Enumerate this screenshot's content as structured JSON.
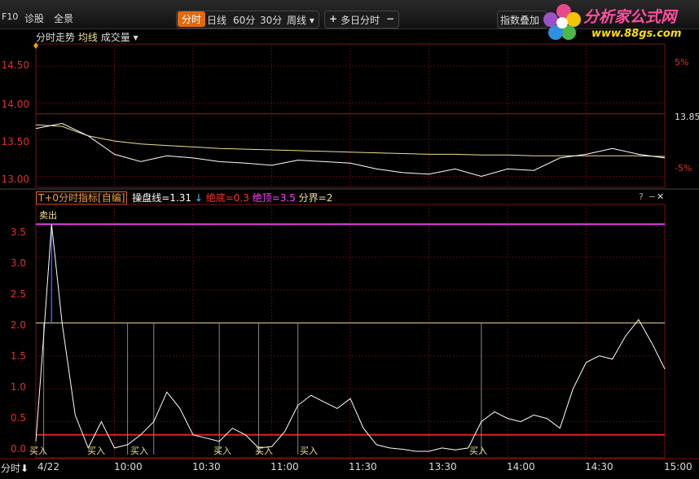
{
  "toolbar": {
    "f10": "F10",
    "diagnose": "诊股",
    "panorama": "全景",
    "periods": [
      "分时",
      "日线",
      "60分",
      "30分",
      "周线 ▾"
    ],
    "multiday": "多日分时",
    "plus": "+",
    "minus": "−",
    "index_overlay": "指数叠加"
  },
  "logo": {
    "text": "分析家公式网",
    "url": "www.88gs.com"
  },
  "top_panel": {
    "title": "分时走势",
    "avg_label": "均线",
    "vol_label": "成交量",
    "dropdown": "▾",
    "y_left": [
      "14.50",
      "14.00",
      "13.50",
      "13.00"
    ],
    "y_right": [
      "5%",
      "13.85",
      "-5%"
    ]
  },
  "bottom_panel": {
    "indicator": "T+0分时指标[自编]",
    "line_label": "操盘线=1.31",
    "arrow": "↓",
    "bottom_label": "绝底=0.3",
    "top_label": "绝顶=3.5",
    "divider_label": "分界=2",
    "help": "?",
    "collapse": "−",
    "close": "✕",
    "sell": "卖出",
    "buy": "买入",
    "y_left": [
      "3.5",
      "3.0",
      "2.5",
      "2.0",
      "1.5",
      "1.0",
      "0.5",
      "0.0"
    ]
  },
  "xaxis": {
    "mode_label": "分时",
    "mode_arrow": "⬇",
    "labels": [
      "4/22",
      "10:00",
      "10:30",
      "11:00",
      "11:30",
      "13:30",
      "14:00",
      "14:30",
      "15:00"
    ]
  },
  "chart_data": {
    "type": "line",
    "price": {
      "ylim": [
        12.85,
        14.8
      ],
      "prev_close": 13.85,
      "times": [
        "09:30",
        "09:40",
        "09:50",
        "10:00",
        "10:10",
        "10:20",
        "10:30",
        "10:40",
        "10:50",
        "11:00",
        "11:10",
        "11:20",
        "11:30",
        "13:10",
        "13:20",
        "13:30",
        "13:40",
        "13:50",
        "14:00",
        "14:10",
        "14:20",
        "14:30",
        "14:40",
        "14:50",
        "15:00"
      ],
      "price": [
        13.65,
        13.72,
        13.55,
        13.3,
        13.2,
        13.28,
        13.25,
        13.2,
        13.18,
        13.15,
        13.22,
        13.2,
        13.18,
        13.1,
        13.05,
        13.03,
        13.1,
        13.0,
        13.1,
        13.08,
        13.25,
        13.3,
        13.38,
        13.3,
        13.25
      ],
      "avg": [
        13.7,
        13.68,
        13.55,
        13.48,
        13.44,
        13.42,
        13.4,
        13.38,
        13.37,
        13.36,
        13.35,
        13.34,
        13.33,
        13.32,
        13.31,
        13.3,
        13.3,
        13.29,
        13.29,
        13.28,
        13.28,
        13.28,
        13.28,
        13.28,
        13.27
      ]
    },
    "indicator": {
      "ylim": [
        0,
        3.8
      ],
      "times": [
        "09:30",
        "09:33",
        "09:36",
        "09:40",
        "09:45",
        "09:50",
        "09:55",
        "10:00",
        "10:05",
        "10:10",
        "10:15",
        "10:20",
        "10:25",
        "10:30",
        "10:35",
        "10:40",
        "10:45",
        "10:50",
        "10:55",
        "11:00",
        "11:05",
        "11:10",
        "11:15",
        "11:20",
        "11:25",
        "11:30",
        "13:05",
        "13:10",
        "13:15",
        "13:20",
        "13:25",
        "13:30",
        "13:35",
        "13:40",
        "13:45",
        "13:50",
        "13:55",
        "14:00",
        "14:05",
        "14:10",
        "14:15",
        "14:20",
        "14:25",
        "14:30",
        "14:35",
        "14:40",
        "14:45",
        "14:50",
        "14:55",
        "15:00"
      ],
      "values": [
        0.2,
        1.8,
        3.5,
        2.0,
        0.6,
        0.1,
        0.5,
        0.1,
        0.15,
        0.3,
        0.5,
        0.95,
        0.7,
        0.3,
        0.25,
        0.2,
        0.4,
        0.3,
        0.1,
        0.12,
        0.35,
        0.75,
        0.9,
        0.8,
        0.7,
        0.85,
        0.4,
        0.15,
        0.1,
        0.08,
        0.05,
        0.05,
        0.1,
        0.07,
        0.1,
        0.5,
        0.65,
        0.55,
        0.5,
        0.6,
        0.55,
        0.4,
        1.0,
        1.4,
        1.5,
        1.45,
        1.8,
        2.05,
        1.7,
        1.3
      ],
      "top": 3.5,
      "divider": 2.0,
      "bottom": 0.3
    }
  }
}
